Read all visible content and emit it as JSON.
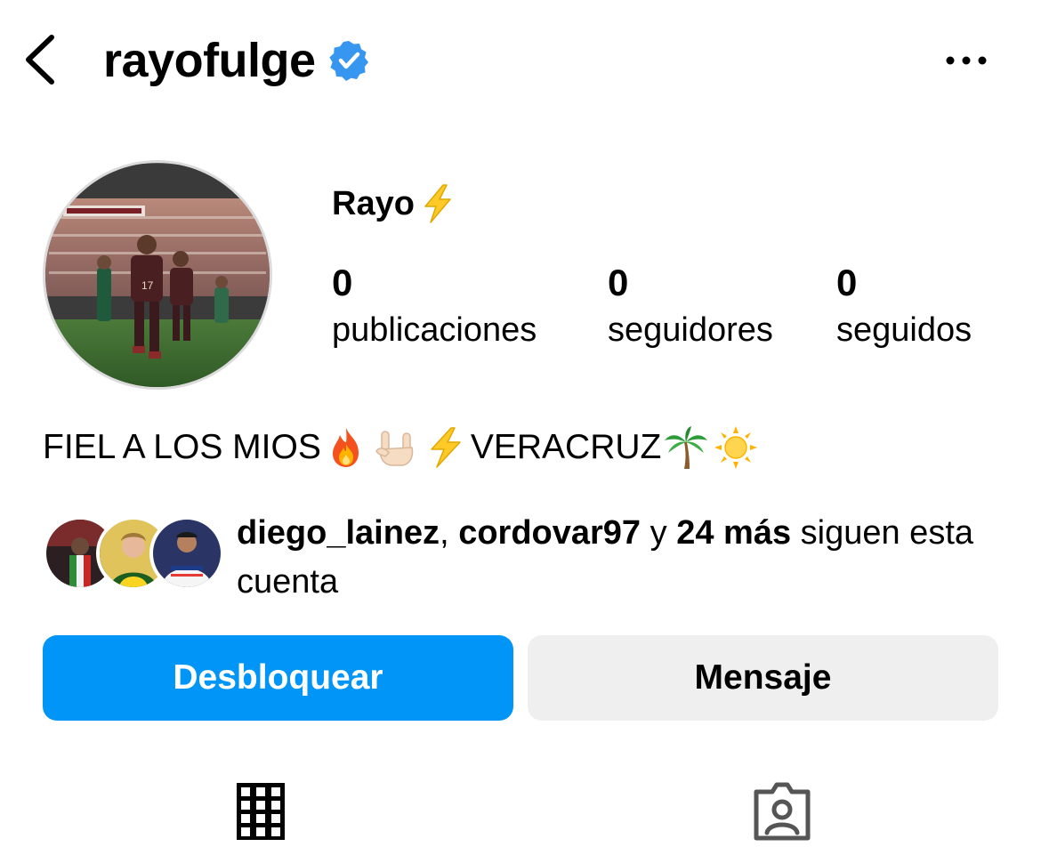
{
  "header": {
    "username": "rayofulge",
    "verified": true,
    "accent_color": "#3797f0"
  },
  "profile": {
    "display_name": "Rayo",
    "stats": [
      {
        "value": "0",
        "label": "publicaciones"
      },
      {
        "value": "0",
        "label": "seguidores"
      },
      {
        "value": "0",
        "label": "seguidos"
      }
    ],
    "bio": {
      "part1": "FIEL A LOS MIOS",
      "part2": "VERACRUZ",
      "emojis": [
        "fire-icon",
        "sign-of-horns-icon",
        "lightning-icon",
        "palm-tree-icon",
        "sun-icon"
      ]
    },
    "followed_by": {
      "user1": "diego_lainez",
      "separator": ", ",
      "user2": "cordovar97",
      "connector": " y ",
      "more": "24 más",
      "suffix": " siguen esta cuenta"
    }
  },
  "actions": {
    "primary_label": "Desbloquear",
    "secondary_label": "Mensaje",
    "primary_color": "#0095f6",
    "secondary_color": "#efefef"
  },
  "tabs": [
    {
      "icon": "grid-icon"
    },
    {
      "icon": "tagged-person-icon"
    }
  ]
}
